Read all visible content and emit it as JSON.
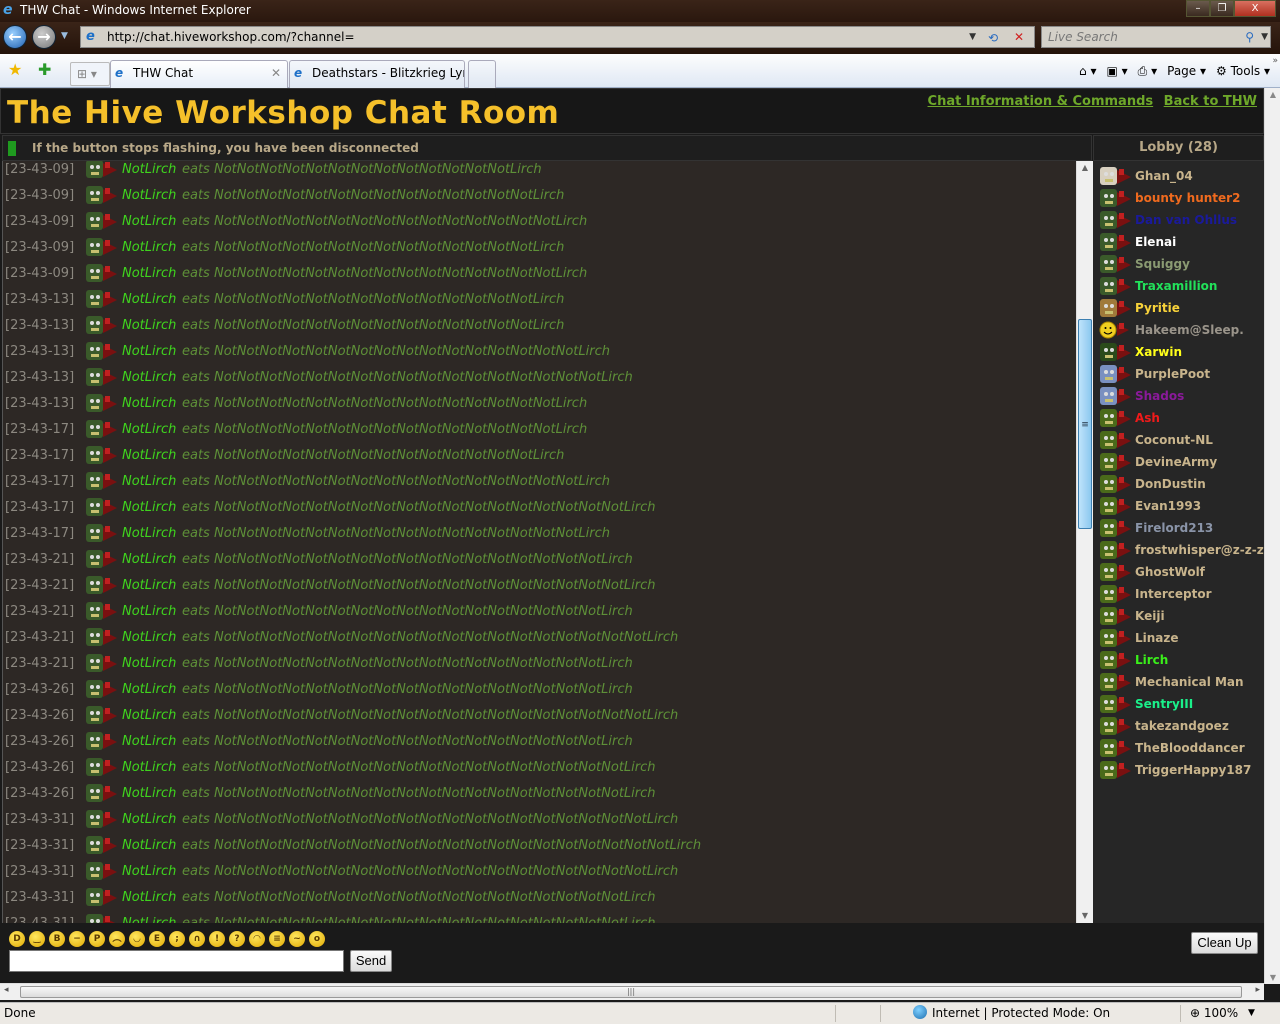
{
  "window": {
    "title": "THW Chat - Windows Internet Explorer",
    "minimize": "–",
    "restore": "❐",
    "close": "X"
  },
  "nav": {
    "back": "←",
    "forward": "→",
    "url": "http://chat.hiveworkshop.com/?channel=",
    "search_placeholder": "Live Search"
  },
  "tabs": [
    {
      "label": "THW Chat",
      "active": true
    },
    {
      "label": "Deathstars - Blitzkrieg Lyri...",
      "active": false
    }
  ],
  "command_bar": {
    "home": "⌂ ▾",
    "feeds": "▣ ▾",
    "print": "⎙ ▾",
    "page": "Page ▾",
    "tools": "⚙ Tools ▾"
  },
  "page": {
    "title": "The Hive Workshop Chat Room",
    "links": [
      {
        "label": "Chat Information & Commands"
      },
      {
        "label": "Back to THW"
      }
    ],
    "connection_message": "If the button stops flashing, you have been disconnected",
    "lobby_header": "Lobby (28)"
  },
  "chat": {
    "messages": [
      {
        "time": "[23-43-09]",
        "user": "NotLirch",
        "text": "eats NotNotNotNotNotNotNotNotNotNotNotNotNotLirch"
      },
      {
        "time": "[23-43-09]",
        "user": "NotLirch",
        "text": "eats NotNotNotNotNotNotNotNotNotNotNotNotNotNotLirch"
      },
      {
        "time": "[23-43-09]",
        "user": "NotLirch",
        "text": "eats NotNotNotNotNotNotNotNotNotNotNotNotNotNotNotLirch"
      },
      {
        "time": "[23-43-09]",
        "user": "NotLirch",
        "text": "eats NotNotNotNotNotNotNotNotNotNotNotNotNotNotLirch"
      },
      {
        "time": "[23-43-09]",
        "user": "NotLirch",
        "text": "eats NotNotNotNotNotNotNotNotNotNotNotNotNotNotNotLirch"
      },
      {
        "time": "[23-43-13]",
        "user": "NotLirch",
        "text": "eats NotNotNotNotNotNotNotNotNotNotNotNotNotNotLirch"
      },
      {
        "time": "[23-43-13]",
        "user": "NotLirch",
        "text": "eats NotNotNotNotNotNotNotNotNotNotNotNotNotNotLirch"
      },
      {
        "time": "[23-43-13]",
        "user": "NotLirch",
        "text": "eats NotNotNotNotNotNotNotNotNotNotNotNotNotNotNotNotLirch"
      },
      {
        "time": "[23-43-13]",
        "user": "NotLirch",
        "text": "eats NotNotNotNotNotNotNotNotNotNotNotNotNotNotNotNotNotLirch"
      },
      {
        "time": "[23-43-13]",
        "user": "NotLirch",
        "text": "eats NotNotNotNotNotNotNotNotNotNotNotNotNotNotNotLirch"
      },
      {
        "time": "[23-43-17]",
        "user": "NotLirch",
        "text": "eats NotNotNotNotNotNotNotNotNotNotNotNotNotNotNotLirch"
      },
      {
        "time": "[23-43-17]",
        "user": "NotLirch",
        "text": "eats NotNotNotNotNotNotNotNotNotNotNotNotNotNotLirch"
      },
      {
        "time": "[23-43-17]",
        "user": "NotLirch",
        "text": "eats NotNotNotNotNotNotNotNotNotNotNotNotNotNotNotNotLirch"
      },
      {
        "time": "[23-43-17]",
        "user": "NotLirch",
        "text": "eats NotNotNotNotNotNotNotNotNotNotNotNotNotNotNotNotNotNotLirch"
      },
      {
        "time": "[23-43-17]",
        "user": "NotLirch",
        "text": "eats NotNotNotNotNotNotNotNotNotNotNotNotNotNotNotNotLirch"
      },
      {
        "time": "[23-43-21]",
        "user": "NotLirch",
        "text": "eats NotNotNotNotNotNotNotNotNotNotNotNotNotNotNotNotNotLirch"
      },
      {
        "time": "[23-43-21]",
        "user": "NotLirch",
        "text": "eats NotNotNotNotNotNotNotNotNotNotNotNotNotNotNotNotNotNotLirch"
      },
      {
        "time": "[23-43-21]",
        "user": "NotLirch",
        "text": "eats NotNotNotNotNotNotNotNotNotNotNotNotNotNotNotNotNotLirch"
      },
      {
        "time": "[23-43-21]",
        "user": "NotLirch",
        "text": "eats NotNotNotNotNotNotNotNotNotNotNotNotNotNotNotNotNotNotNotLirch"
      },
      {
        "time": "[23-43-21]",
        "user": "NotLirch",
        "text": "eats NotNotNotNotNotNotNotNotNotNotNotNotNotNotNotNotNotLirch"
      },
      {
        "time": "[23-43-26]",
        "user": "NotLirch",
        "text": "eats NotNotNotNotNotNotNotNotNotNotNotNotNotNotNotNotNotLirch"
      },
      {
        "time": "[23-43-26]",
        "user": "NotLirch",
        "text": "eats NotNotNotNotNotNotNotNotNotNotNotNotNotNotNotNotNotNotNotLirch"
      },
      {
        "time": "[23-43-26]",
        "user": "NotLirch",
        "text": "eats NotNotNotNotNotNotNotNotNotNotNotNotNotNotNotNotNotLirch"
      },
      {
        "time": "[23-43-26]",
        "user": "NotLirch",
        "text": "eats NotNotNotNotNotNotNotNotNotNotNotNotNotNotNotNotNotNotLirch"
      },
      {
        "time": "[23-43-26]",
        "user": "NotLirch",
        "text": "eats NotNotNotNotNotNotNotNotNotNotNotNotNotNotNotNotNotNotLirch"
      },
      {
        "time": "[23-43-31]",
        "user": "NotLirch",
        "text": "eats NotNotNotNotNotNotNotNotNotNotNotNotNotNotNotNotNotNotNotLirch"
      },
      {
        "time": "[23-43-31]",
        "user": "NotLirch",
        "text": "eats NotNotNotNotNotNotNotNotNotNotNotNotNotNotNotNotNotNotNotNotLirch"
      },
      {
        "time": "[23-43-31]",
        "user": "NotLirch",
        "text": "eats NotNotNotNotNotNotNotNotNotNotNotNotNotNotNotNotNotNotNotLirch"
      },
      {
        "time": "[23-43-31]",
        "user": "NotLirch",
        "text": "eats NotNotNotNotNotNotNotNotNotNotNotNotNotNotNotNotNotNotLirch"
      },
      {
        "time": "[23-43-31]",
        "user": "NotLirch",
        "text": "eats NotNotNotNotNotNotNotNotNotNotNotNotNotNotNotNotNotNotLirch"
      }
    ]
  },
  "lobby": {
    "users": [
      {
        "name": "Ghan_04",
        "color": "#c8b48c",
        "avatar": "skull"
      },
      {
        "name": "bounty hunter2",
        "color": "#f06a1e",
        "avatar": "orc"
      },
      {
        "name": "Dan van Ohllus",
        "color": "#1a1a9a",
        "avatar": "orc"
      },
      {
        "name": "Elenai",
        "color": "#ffffff",
        "avatar": "orc"
      },
      {
        "name": "Squiggy",
        "color": "#8a9a72",
        "avatar": "orc"
      },
      {
        "name": "Traxamillion",
        "color": "#22e05a",
        "avatar": "orc"
      },
      {
        "name": "Pyritie",
        "color": "#f8d23a",
        "avatar": "weapons"
      },
      {
        "name": "Hakeem@Sleep.",
        "color": "#9a948a",
        "avatar": "smiley"
      },
      {
        "name": "Xarwin",
        "color": "#ffff1a",
        "avatar": "helm"
      },
      {
        "name": "PurplePoot",
        "color": "#c8b48c",
        "avatar": "ghost"
      },
      {
        "name": "Shados",
        "color": "#8a1a9a",
        "avatar": "ghost"
      },
      {
        "name": "Ash",
        "color": "#f01a1a",
        "avatar": "grunt"
      },
      {
        "name": "Coconut-NL",
        "color": "#c8b48c",
        "avatar": "grunt"
      },
      {
        "name": "DevineArmy",
        "color": "#c8b48c",
        "avatar": "grunt"
      },
      {
        "name": "DonDustin",
        "color": "#c8b48c",
        "avatar": "grunt"
      },
      {
        "name": "Evan1993",
        "color": "#c8b48c",
        "avatar": "grunt"
      },
      {
        "name": "Firelord213",
        "color": "#8a94a8",
        "avatar": "grunt"
      },
      {
        "name": "frostwhisper@z-z-z",
        "color": "#c8b48c",
        "avatar": "grunt"
      },
      {
        "name": "GhostWolf",
        "color": "#c8b48c",
        "avatar": "grunt"
      },
      {
        "name": "Interceptor",
        "color": "#c8b48c",
        "avatar": "grunt"
      },
      {
        "name": "Keiji",
        "color": "#c8b48c",
        "avatar": "grunt"
      },
      {
        "name": "Linaze",
        "color": "#c8b48c",
        "avatar": "grunt"
      },
      {
        "name": "Lirch",
        "color": "#3af01a",
        "avatar": "grunt"
      },
      {
        "name": "Mechanical Man",
        "color": "#c8b48c",
        "avatar": "grunt"
      },
      {
        "name": "SentryIII",
        "color": "#1af08a",
        "avatar": "grunt"
      },
      {
        "name": "takezandgoez",
        "color": "#c8b48c",
        "avatar": "grunt"
      },
      {
        "name": "TheBlooddancer",
        "color": "#c8b48c",
        "avatar": "grunt"
      },
      {
        "name": "TriggerHappy187",
        "color": "#c8b48c",
        "avatar": "grunt"
      }
    ]
  },
  "composer": {
    "smileys": [
      "grin",
      "smile",
      "cool",
      "neutral",
      "tongue",
      "sad",
      "happy",
      "teeth",
      "wink",
      "frown",
      "exclaim",
      "idea",
      "laugh",
      "angry",
      "confused",
      "eek"
    ],
    "message_value": "",
    "send_label": "Send",
    "cleanup_label": "Clean Up"
  },
  "statusbar": {
    "left": "Done",
    "zone": "Internet | Protected Mode: On",
    "zoom": "100%"
  },
  "colors": {
    "title_gold": "#f5c02a",
    "link_green": "#6ea82a",
    "chat_name_green": "#3fd41e",
    "chat_text_green": "#5e9038",
    "chat_bg": "#2d2825"
  }
}
